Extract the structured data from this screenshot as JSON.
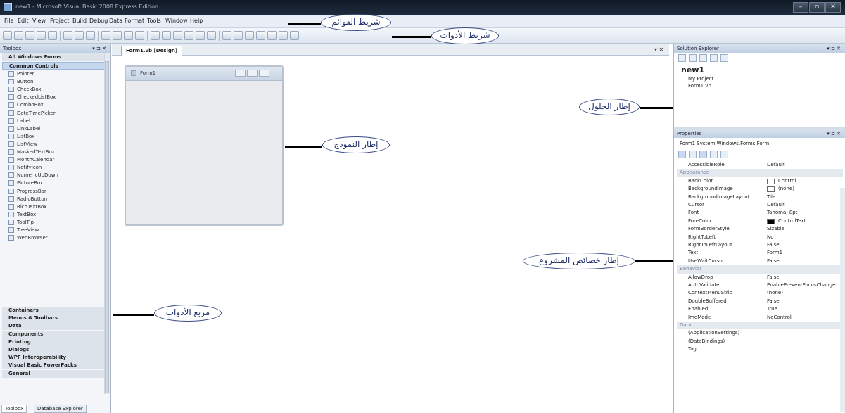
{
  "window": {
    "title": "new1 - Microsoft Visual Basic 2008 Express Edition",
    "buttons": [
      "–",
      "▫",
      "✕"
    ]
  },
  "menu": {
    "items": [
      "File",
      "Edit",
      "View",
      "Project",
      "Build",
      "Debug",
      "Data",
      "Format",
      "Tools",
      "Window",
      "Help"
    ]
  },
  "toolbox": {
    "title": "Toolbox",
    "pin": "▾ ⊐ ✕",
    "categories_top": [
      "All Windows Forms",
      "Common Controls"
    ],
    "items": [
      "Pointer",
      "Button",
      "CheckBox",
      "CheckedListBox",
      "ComboBox",
      "DateTimePicker",
      "Label",
      "LinkLabel",
      "ListBox",
      "ListView",
      "MaskedTextBox",
      "MonthCalendar",
      "NotifyIcon",
      "NumericUpDown",
      "PictureBox",
      "ProgressBar",
      "RadioButton",
      "RichTextBox",
      "TextBox",
      "ToolTip",
      "TreeView",
      "WebBrowser"
    ],
    "categories_bottom": [
      "Containers",
      "Menus & Toolbars",
      "Data",
      "Components",
      "Printing",
      "Dialogs",
      "WPF Interoperability",
      "Visual Basic PowerPacks",
      "General"
    ],
    "bottom_tabs": [
      "Toolbox",
      "Database Explorer"
    ]
  },
  "document": {
    "tab": "Form1.vb [Design]",
    "close": "▾ ✕",
    "form_title": "Form1"
  },
  "solution_explorer": {
    "title": "Solution Explorer",
    "pin": "▾ ⊐ ✕",
    "solution": "new1",
    "nodes": [
      "My Project",
      "Form1.vb"
    ]
  },
  "properties": {
    "title": "Properties",
    "pin": "▾ ⊐ ✕",
    "object": "Form1  System.Windows.Forms.Form",
    "rows": [
      {
        "kind": "prop",
        "name": "AccessibleRole",
        "value": "Default"
      },
      {
        "kind": "cat",
        "name": "Appearance"
      },
      {
        "kind": "prop",
        "name": "BackColor",
        "value": "Control",
        "swatch": "#ffffff"
      },
      {
        "kind": "prop",
        "name": "BackgroundImage",
        "value": "(none)",
        "swatch": "#ffffff"
      },
      {
        "kind": "prop",
        "name": "BackgroundImageLayout",
        "value": "Tile"
      },
      {
        "kind": "prop",
        "name": "Cursor",
        "value": "Default"
      },
      {
        "kind": "prop",
        "name": "Font",
        "value": "Tahoma; 8pt",
        "expand": true
      },
      {
        "kind": "prop",
        "name": "ForeColor",
        "value": "ControlText",
        "swatch": "#000000"
      },
      {
        "kind": "prop",
        "name": "FormBorderStyle",
        "value": "Sizable"
      },
      {
        "kind": "prop",
        "name": "RightToLeft",
        "value": "No"
      },
      {
        "kind": "prop",
        "name": "RightToLeftLayout",
        "value": "False"
      },
      {
        "kind": "prop",
        "name": "Text",
        "value": "Form1"
      },
      {
        "kind": "prop",
        "name": "UseWaitCursor",
        "value": "False"
      },
      {
        "kind": "cat",
        "name": "Behavior"
      },
      {
        "kind": "prop",
        "name": "AllowDrop",
        "value": "False"
      },
      {
        "kind": "prop",
        "name": "AutoValidate",
        "value": "EnablePreventFocusChange"
      },
      {
        "kind": "prop",
        "name": "ContextMenuStrip",
        "value": "(none)"
      },
      {
        "kind": "prop",
        "name": "DoubleBuffered",
        "value": "False"
      },
      {
        "kind": "prop",
        "name": "Enabled",
        "value": "True"
      },
      {
        "kind": "prop",
        "name": "ImeMode",
        "value": "NoControl"
      },
      {
        "kind": "cat",
        "name": "Data"
      },
      {
        "kind": "prop",
        "name": "(ApplicationSettings)",
        "value": "",
        "expand": true
      },
      {
        "kind": "prop",
        "name": "(DataBindings)",
        "value": "",
        "expand": true
      },
      {
        "kind": "prop",
        "name": "Tag",
        "value": ""
      }
    ]
  },
  "callouts": {
    "menu_bar": "شريط القوائم",
    "toolbar": "شريط الأدوات",
    "solution": "إطار الحلول",
    "form": "إطار النموذج",
    "properties": "إطار خصائص المشروع",
    "toolbox": "مربع الأدوات"
  },
  "colors": {
    "callout_border": "#3b4e86",
    "leader": "#000000",
    "titlebar": "#111a26"
  }
}
